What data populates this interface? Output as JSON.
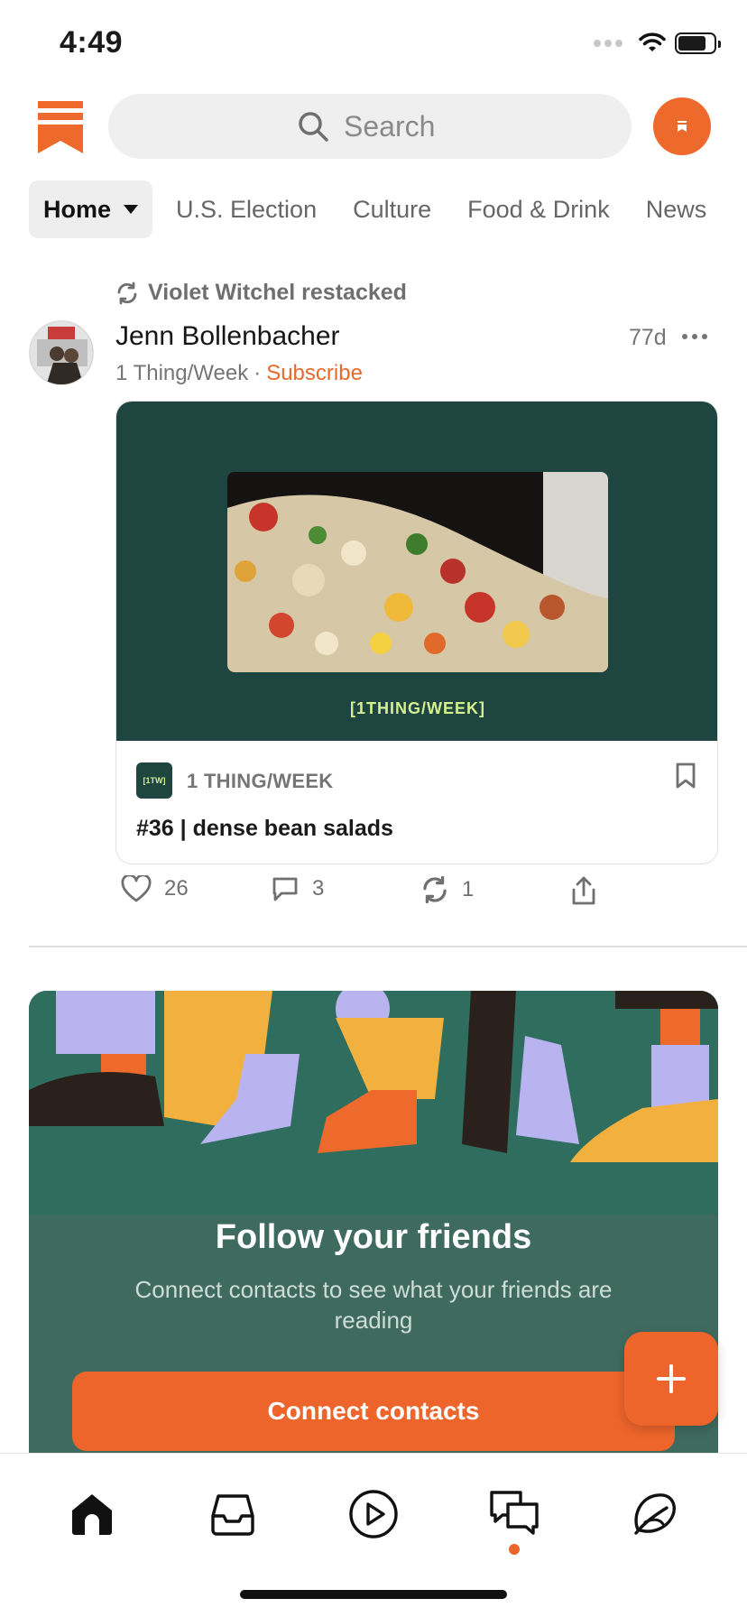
{
  "status_bar": {
    "time": "4:49",
    "battery_level": 0.8
  },
  "header": {
    "logo_icon": "substack-bookmark-logo",
    "search_placeholder": "Search",
    "profile_icon": "profile-avatar"
  },
  "tabs": [
    {
      "label": "Home",
      "active": true
    },
    {
      "label": "U.S. Election",
      "active": false
    },
    {
      "label": "Culture",
      "active": false
    },
    {
      "label": "Food & Drink",
      "active": false
    },
    {
      "label": "News",
      "active": false
    }
  ],
  "post": {
    "restacked_by": "Violet Witchel restacked",
    "author": "Jenn Bollenbacher",
    "age": "77d",
    "publication": "1 Thing/Week",
    "separator": "·",
    "subscribe_label": "Subscribe",
    "card": {
      "hero_brand": "[1THING/WEEK]",
      "pub_logo_text": "[1TW]",
      "pub_name": "1 THING/WEEK",
      "title": "#36 | dense bean salads"
    },
    "actions": {
      "likes": "26",
      "comments": "3",
      "restacks": "1"
    }
  },
  "promo": {
    "title": "Follow your friends",
    "subtitle": "Connect contacts to see what your friends are reading",
    "button_label": "Connect contacts"
  },
  "bottom_nav": [
    {
      "name": "home",
      "icon": "home-icon",
      "active": true
    },
    {
      "name": "inbox",
      "icon": "inbox-icon",
      "active": false
    },
    {
      "name": "media",
      "icon": "play-icon",
      "active": false
    },
    {
      "name": "chat",
      "icon": "chat-icon",
      "active": false,
      "badge": true
    },
    {
      "name": "explore",
      "icon": "explore-icon",
      "active": false
    }
  ],
  "colors": {
    "accent": "#ed652b",
    "card_green": "#1e453f",
    "promo_green": "#3f6b5f"
  }
}
